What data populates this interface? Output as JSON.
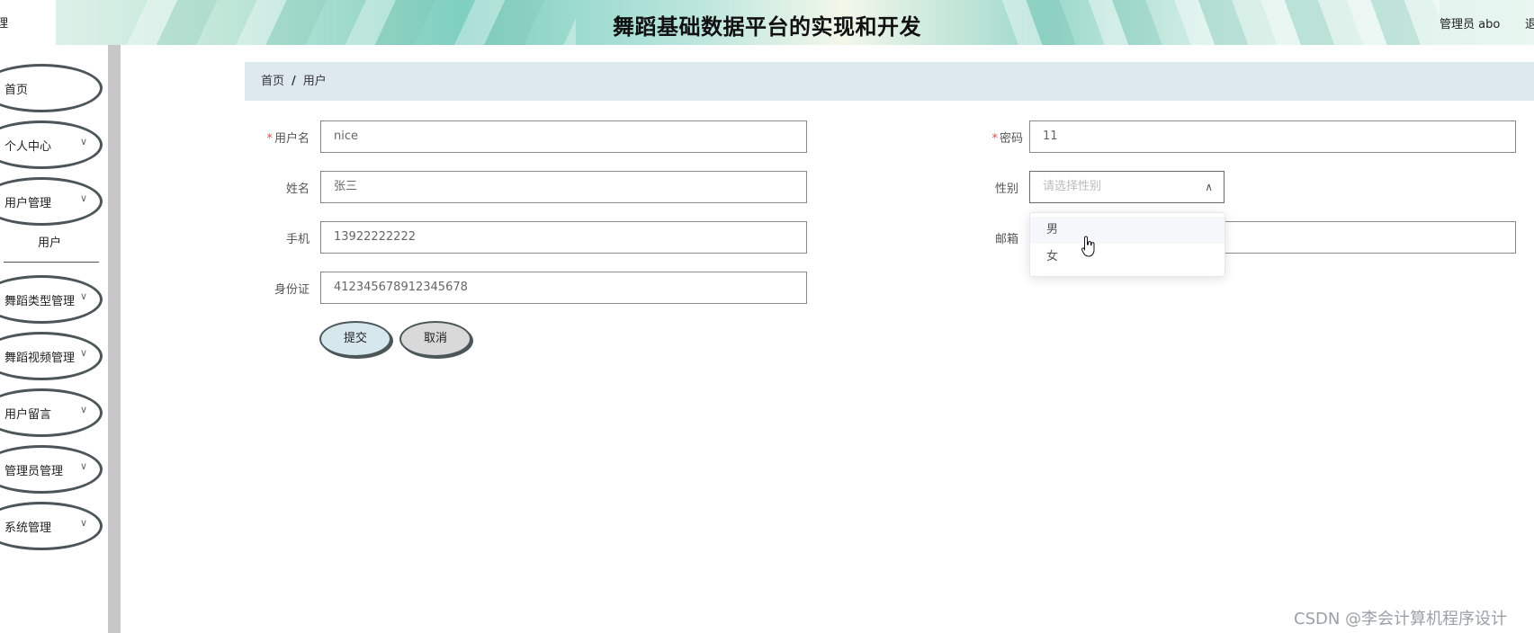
{
  "header": {
    "logo_text": "理",
    "title": "舞蹈基础数据平台的实现和开发",
    "user": "管理员 abo",
    "logout": "退出"
  },
  "sidebar": {
    "items": [
      {
        "label": "首页"
      },
      {
        "label": "个人中心",
        "chevron": "∨"
      },
      {
        "label": "用户管理",
        "chevron": "∨"
      },
      {
        "label": "舞蹈类型管理",
        "chevron": "∨"
      },
      {
        "label": "舞蹈视频管理",
        "chevron": "∨"
      },
      {
        "label": "用户留言",
        "chevron": "∨"
      },
      {
        "label": "管理员管理",
        "chevron": "∨"
      },
      {
        "label": "系统管理",
        "chevron": "∨"
      }
    ],
    "sub_item": "用户"
  },
  "breadcrumb": {
    "home": "首页",
    "separator": "/",
    "current": "用户"
  },
  "form": {
    "username": {
      "label": "用户名",
      "required": "*",
      "value": "nice"
    },
    "password": {
      "label": "密码",
      "required": "*",
      "value": "11"
    },
    "name": {
      "label": "姓名",
      "value": "张三"
    },
    "gender": {
      "label": "性别",
      "placeholder": "请选择性别",
      "arrow": "∧"
    },
    "phone": {
      "label": "手机",
      "value": "13922222222"
    },
    "email": {
      "label": "邮箱",
      "value": ""
    },
    "id_card": {
      "label": "身份证",
      "value": "412345678912345678"
    }
  },
  "gender_options": [
    "男",
    "女"
  ],
  "buttons": {
    "submit": "提交",
    "cancel": "取消"
  },
  "watermark": "CSDN @李会计算机程序设计",
  "colors": {
    "breadcrumb_bg": "#dde9ee",
    "sidebar_scrollbar": "#c9c6c9",
    "required": "#e04b4b",
    "submit_bg": "#d6e8ee",
    "cancel_bg": "#d9d9d9"
  }
}
